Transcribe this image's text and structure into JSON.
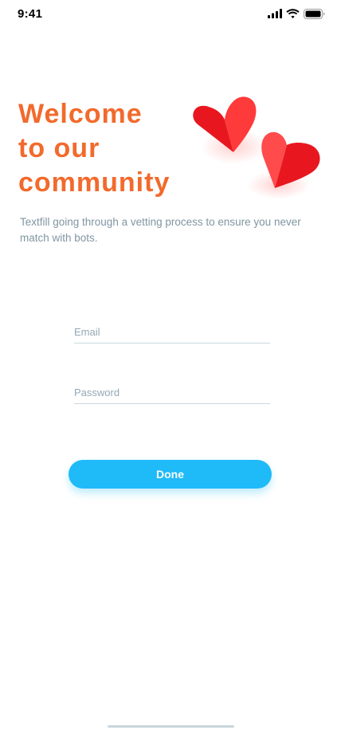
{
  "status_bar": {
    "time": "9:41",
    "icons": [
      "cellular-signal-icon",
      "wifi-icon",
      "battery-icon"
    ]
  },
  "welcome": {
    "title_lines": [
      "Welcome",
      "to our",
      "community"
    ],
    "subtitle": "Textfill going through a vetting process to ensure you never match with bots."
  },
  "illustration": {
    "name": "hearts-icon",
    "colors": [
      "#e8171f",
      "#ff3d3d",
      "#ff5a52"
    ]
  },
  "form": {
    "email": {
      "placeholder": "Email",
      "value": ""
    },
    "password": {
      "placeholder": "Password",
      "value": ""
    },
    "done_label": "Done"
  },
  "colors": {
    "accent_title": "#f26a2c",
    "button": "#1fbaf8",
    "subtitle_text": "#8096a2",
    "field_line": "#c8dade"
  }
}
